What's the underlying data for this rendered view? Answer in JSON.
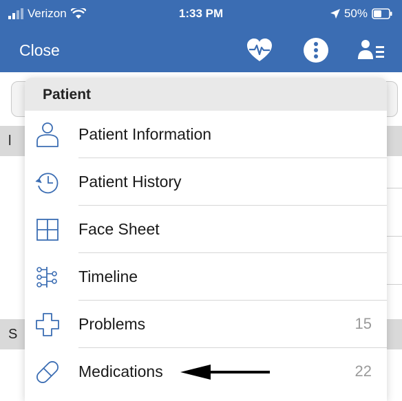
{
  "status_bar": {
    "carrier": "Verizon",
    "time": "1:33 PM",
    "battery": "50%"
  },
  "nav": {
    "close_label": "Close",
    "icons": [
      "heart-rate-icon",
      "more-icon",
      "patient-menu-icon"
    ]
  },
  "background": {
    "section_labels": [
      "l",
      "S"
    ]
  },
  "menu": {
    "header": "Patient",
    "items": [
      {
        "label": "Patient Information",
        "icon": "person-icon",
        "count": ""
      },
      {
        "label": "Patient History",
        "icon": "history-clock-icon",
        "count": ""
      },
      {
        "label": "Face Sheet",
        "icon": "grid-icon",
        "count": ""
      },
      {
        "label": "Timeline",
        "icon": "timeline-icon",
        "count": ""
      },
      {
        "label": "Problems",
        "icon": "medical-cross-icon",
        "count": "15"
      },
      {
        "label": "Medications",
        "icon": "pill-icon",
        "count": "22"
      }
    ]
  },
  "colors": {
    "nav_background": "#3b6db3",
    "icon_accent": "#3b6db3",
    "menu_header_bg": "#e9e9e9"
  }
}
